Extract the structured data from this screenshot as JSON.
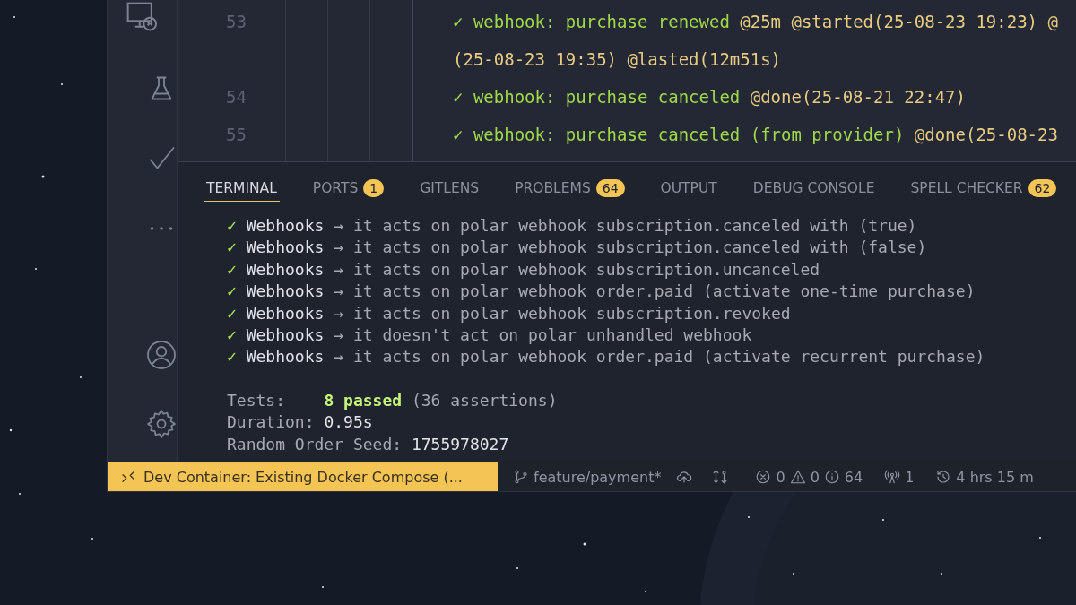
{
  "editor": {
    "lines": [
      {
        "number": "53",
        "segments": [
          {
            "kind": "text",
            "text": "✓ webhook: purchase renewed "
          },
          {
            "kind": "tag",
            "text": "@25m @started(25-08-23 19:23) @"
          }
        ]
      },
      {
        "segments": [
          {
            "kind": "tag",
            "text": "(25-08-23 19:35) @lasted(12m51s)"
          }
        ]
      },
      {
        "number": "54",
        "segments": [
          {
            "kind": "text",
            "text": "✓ webhook: purchase canceled "
          },
          {
            "kind": "tag",
            "text": "@done(25-08-21 22:47)"
          }
        ]
      },
      {
        "number": "55",
        "segments": [
          {
            "kind": "text",
            "text": "✓ webhook: purchase canceled (from provider) "
          },
          {
            "kind": "tag",
            "text": "@done(25-08-23"
          }
        ]
      }
    ]
  },
  "panel": {
    "tabs": [
      {
        "label": "TERMINAL",
        "selected": true
      },
      {
        "label": "PORTS",
        "badge": "1",
        "selected": false
      },
      {
        "label": "GITLENS",
        "selected": false
      },
      {
        "label": "PROBLEMS",
        "badge": "64",
        "selected": false
      },
      {
        "label": "OUTPUT",
        "selected": false
      },
      {
        "label": "DEBUG CONSOLE",
        "selected": false
      },
      {
        "label": "SPELL CHECKER",
        "badge": "62",
        "selected": false
      }
    ],
    "terminal": {
      "results": [
        {
          "check": "✓",
          "subject": "Webhooks",
          "text": "→ it acts on polar webhook subscription.canceled with (true)"
        },
        {
          "check": "✓",
          "subject": "Webhooks",
          "text": "→ it acts on polar webhook subscription.canceled with (false)"
        },
        {
          "check": "✓",
          "subject": "Webhooks",
          "text": "→ it acts on polar webhook subscription.uncanceled"
        },
        {
          "check": "✓",
          "subject": "Webhooks",
          "text": "→ it acts on polar webhook order.paid (activate one-time purchase)"
        },
        {
          "check": "✓",
          "subject": "Webhooks",
          "text": "→ it acts on polar webhook subscription.revoked"
        },
        {
          "check": "✓",
          "subject": "Webhooks",
          "text": "→ it doesn't act on polar unhandled webhook"
        },
        {
          "check": "✓",
          "subject": "Webhooks",
          "text": "→ it acts on polar webhook order.paid (activate recurrent purchase)"
        }
      ],
      "summary": [
        {
          "segments": [
            {
              "kind": "label",
              "text": "Tests:    "
            },
            {
              "kind": "pass",
              "text": "8 passed"
            },
            {
              "kind": "label",
              "text": " (36 assertions)"
            }
          ]
        },
        {
          "segments": [
            {
              "kind": "label",
              "text": "Duration: "
            },
            {
              "kind": "value",
              "text": "0.95s"
            }
          ]
        },
        {
          "segments": [
            {
              "kind": "label",
              "text": "Random Order Seed: "
            },
            {
              "kind": "value",
              "text": "1755978027"
            }
          ]
        }
      ]
    }
  },
  "status_bar": {
    "remote": "Dev Container: Existing Docker Compose (...",
    "branch": "feature/payment*",
    "errors": "0",
    "warnings": "0",
    "infos": "64",
    "ports": "1",
    "time": "4 hrs 15 m"
  }
}
